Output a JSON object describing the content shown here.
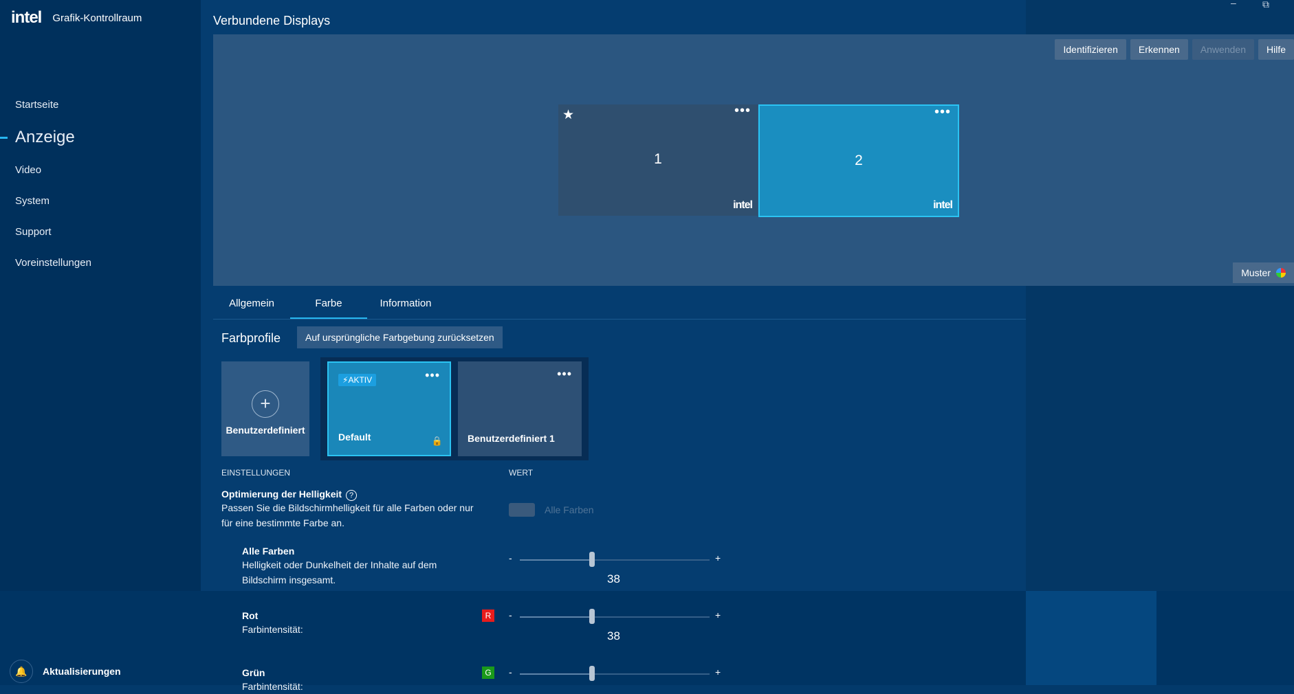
{
  "app": {
    "logo": "intel",
    "title": "Grafik-Kontrollraum"
  },
  "window": {
    "minimize_glyph": "–",
    "restore_glyph": "⧉"
  },
  "nav": [
    {
      "label": "Startseite"
    },
    {
      "label": "Anzeige"
    },
    {
      "label": "Video"
    },
    {
      "label": "System"
    },
    {
      "label": "Support"
    },
    {
      "label": "Voreinstellungen"
    }
  ],
  "nav_active": "Anzeige",
  "updates": {
    "label": "Aktualisierungen",
    "icon": "bell-icon"
  },
  "page": {
    "title": "Verbundene Displays"
  },
  "toolbar": {
    "identify": "Identifizieren",
    "detect": "Erkennen",
    "apply": "Anwenden",
    "help": "Hilfe"
  },
  "displays": [
    {
      "number": "1",
      "brand": "intel",
      "primary_icon": "★",
      "more": "•••",
      "selected": false
    },
    {
      "number": "2",
      "brand": "intel",
      "more": "•••",
      "selected": true
    }
  ],
  "muster": {
    "label": "Muster",
    "icon": "color-wheel-icon"
  },
  "tabs": [
    {
      "label": "Allgemein"
    },
    {
      "label": "Farbe"
    },
    {
      "label": "Information"
    }
  ],
  "tab_active": "Farbe",
  "profiles": {
    "title": "Farbprofile",
    "reset_label": "Auf ursprüngliche Farbgebung zurücksetzen",
    "add_label": "Benutzerdefiniert",
    "active_badge": "AKTIV",
    "items": [
      {
        "name": "Default",
        "active": true,
        "locked": true,
        "more": "•••"
      },
      {
        "name": "Benutzerdefiniert 1",
        "active": false,
        "more": "•••"
      }
    ]
  },
  "settings": {
    "col_settings": "EINSTELLUNGEN",
    "col_value": "WERT",
    "brightness": {
      "title": "Optimierung der Helligkeit",
      "help": "?",
      "desc": "Passen Sie die Bildschirmhelligkeit für alle Farben oder nur für eine bestimmte Farbe an.",
      "toggle_label": "Alle Farben",
      "toggle_on": false
    },
    "all_colors": {
      "title": "Alle Farben",
      "desc": "Helligkeit oder Dunkelheit der Inhalte auf dem Bildschirm insgesamt.",
      "value": 38,
      "min_label": "-",
      "max_label": "+"
    },
    "red": {
      "title": "Rot",
      "desc": "Farbintensität:",
      "chip": "R",
      "chip_color": "#e81c1c",
      "value": 38,
      "min_label": "-",
      "max_label": "+"
    },
    "green": {
      "title": "Grün",
      "desc": "Farbintensität:",
      "chip": "G",
      "chip_color": "#1a9a1a",
      "min_label": "-",
      "max_label": "+"
    }
  },
  "slider_position_fraction": 0.38
}
